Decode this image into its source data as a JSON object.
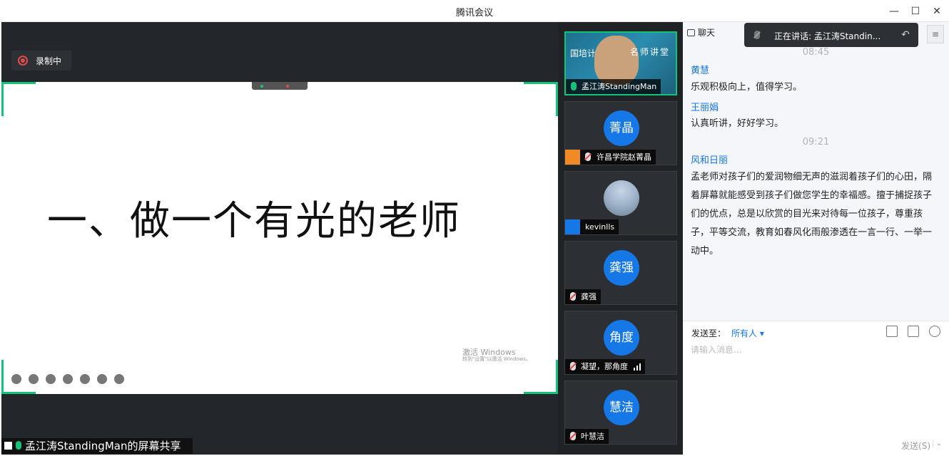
{
  "window": {
    "title": "腾讯会议",
    "minimize": "—",
    "maximize": "☐",
    "close": "✕"
  },
  "stage": {
    "recording_label": "录制中",
    "slide_title": "一、做一个有光的老师",
    "watermark_line1": "激活 Windows",
    "watermark_line2": "转到\"设置\"以激活 Windows。",
    "share_label": "孟江涛StandingMan的屏幕共享"
  },
  "participants": [
    {
      "name": "孟江涛StandingMan",
      "video": true,
      "banner_left": "国培计",
      "banner_right": "名师讲堂",
      "mic": "on"
    },
    {
      "name": "许昌学院赵菁晶",
      "avatar": "菁晶",
      "mic": "muted",
      "badge": "user-orange"
    },
    {
      "name": "kevinlls",
      "avatar_photo": true,
      "badge": "user-blue"
    },
    {
      "name": "龚强",
      "avatar": "龚强",
      "mic": "muted"
    },
    {
      "name": "凝望，那角度",
      "avatar": "角度",
      "mic": "muted",
      "signal": true
    },
    {
      "name": "叶慧洁",
      "avatar": "慧洁",
      "mic": "muted"
    }
  ],
  "chat": {
    "tab_label": "聊天",
    "speaking_text": "正在讲话: 孟江涛Standin...",
    "messages": [
      {
        "time": "08:45"
      },
      {
        "sender": "黄慧",
        "text": "乐观积极向上，值得学习。"
      },
      {
        "sender": "王丽娟",
        "text": "认真听讲，好好学习。"
      },
      {
        "time": "09:21"
      },
      {
        "sender": "风和日丽",
        "text": "孟老师对孩子们的爱润物细无声的滋润着孩子们的心田，隔着屏幕就能感受到孩子们做您学生的幸福感。擅于捕捉孩子们的优点，总是以欣赏的目光来对待每一位孩子，尊重孩子，平等交流，教育如春风化雨般渗透在一言一行、一举一动中。"
      }
    ],
    "send_to_label": "发送至：",
    "send_to_value": "所有人 ▾",
    "input_placeholder": "请输入消息...",
    "send_button": "发送(S)",
    "send_options": "⌄",
    "menu_icon": "≡",
    "reply_icon": "↶"
  }
}
